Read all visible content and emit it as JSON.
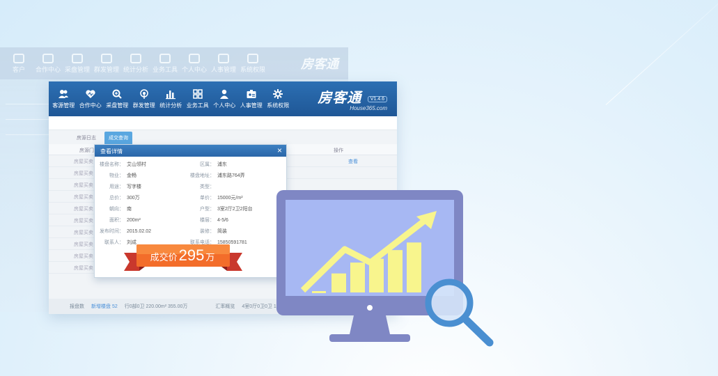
{
  "window": {
    "nav": [
      {
        "label": "客源管理",
        "icon": "users-icon"
      },
      {
        "label": "合作中心",
        "icon": "heart-icon"
      },
      {
        "label": "采盘管理",
        "icon": "search-icon"
      },
      {
        "label": "群发管理",
        "icon": "broadcast-icon"
      },
      {
        "label": "统计分析",
        "icon": "bar-chart-icon"
      },
      {
        "label": "业务工具",
        "icon": "grid-icon"
      },
      {
        "label": "个人中心",
        "icon": "person-icon"
      },
      {
        "label": "人事管理",
        "icon": "id-card-icon"
      },
      {
        "label": "系统权限",
        "icon": "gear-icon"
      }
    ],
    "brand": {
      "logo": "房客通",
      "version": "V1.4.6",
      "site": "House365.com"
    },
    "tabs": [
      "房源日志",
      "成交查询"
    ],
    "list_rows": [
      "房屋买卖",
      "房屋买卖",
      "房屋买卖",
      "房屋买卖",
      "房屋买卖",
      "房屋买卖",
      "房屋买卖",
      "房屋买卖",
      "房屋买卖",
      "房屋买卖"
    ],
    "list_op": "查看",
    "list_head": [
      "房源门",
      "号",
      "操作"
    ]
  },
  "ghost_nav": [
    "客户",
    "合作中心",
    "采盘管理",
    "群发管理",
    "统计分析",
    "业务工具",
    "个人中心",
    "人事管理",
    "系统权限"
  ],
  "dialog": {
    "title": "查看详情",
    "close": "×",
    "left_fields": [
      {
        "k": "楼盘名称：",
        "v": "艾山领村"
      },
      {
        "k": "物业：",
        "v": "金畅"
      },
      {
        "k": "用途：",
        "v": "写字楼"
      },
      {
        "k": "总价：",
        "v": "300万"
      },
      {
        "k": "朝向：",
        "v": "南"
      },
      {
        "k": "面积：",
        "v": "200m²"
      },
      {
        "k": "发布时间：",
        "v": "2015.02.02"
      },
      {
        "k": "联系人：",
        "v": "刘成"
      }
    ],
    "right_fields": [
      {
        "k": "区属：",
        "v": "浦东"
      },
      {
        "k": "楼盘地址：",
        "v": "浦东路764弄"
      },
      {
        "k": "类型：",
        "v": ""
      },
      {
        "k": "单价：",
        "v": "15000元/m²"
      },
      {
        "k": "户型：",
        "v": "3室2厅2卫2阳台"
      },
      {
        "k": "楼层：",
        "v": "4-5/6"
      },
      {
        "k": "装修：",
        "v": "简装"
      },
      {
        "k": "联系电话：",
        "v": "15850591781"
      }
    ]
  },
  "price_banner": {
    "label": "成交价",
    "value": "295",
    "unit": "万"
  },
  "status_bar": {
    "a": "报盘数 ",
    "b": "新增楼盘 52",
    "c": "行0部0卫 220.00m² 355.00万",
    "d": "汇率概览",
    "e": "4室0厅0卫0卫 182.00m² 120.00万"
  },
  "chart_icon": {
    "bars": [
      0.35,
      0.55,
      0.62,
      0.78,
      0.92
    ]
  },
  "colors": {
    "header": "#245f9f",
    "banner": "#f26a2c",
    "monitor": "#7f87c4",
    "screen": "#a7b8f3",
    "bars": "#f8f58d",
    "magnifier": "#4a8fd1"
  }
}
